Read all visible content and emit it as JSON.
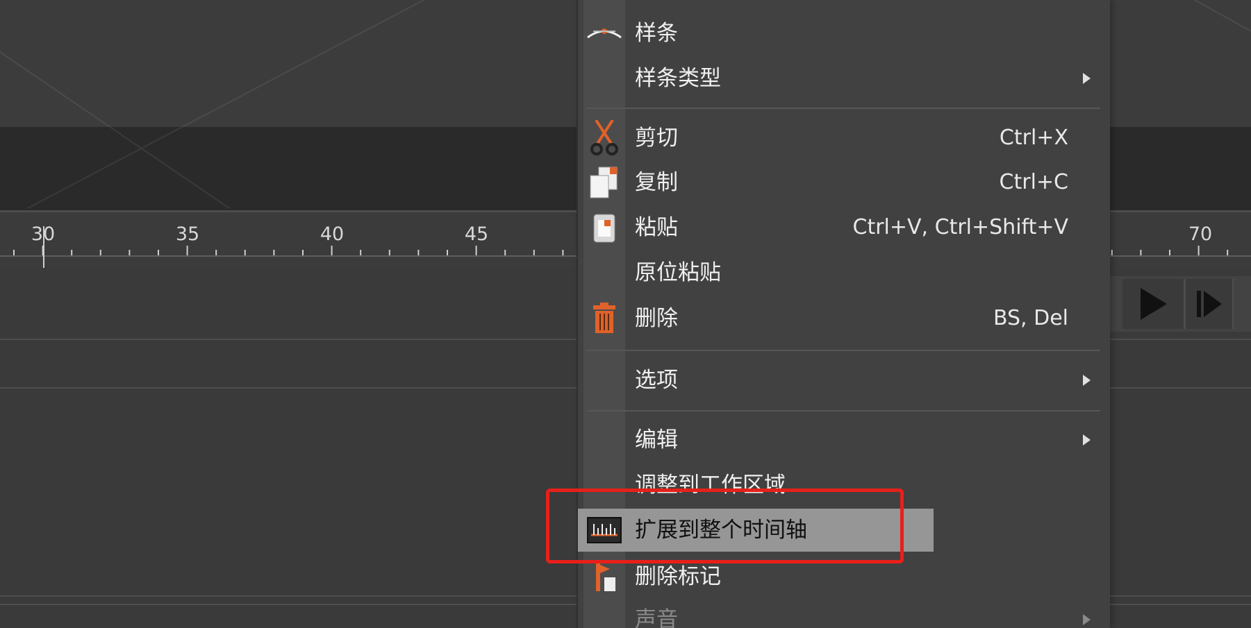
{
  "ruler": {
    "labels": [
      "30",
      "35",
      "40",
      "45",
      "70"
    ]
  },
  "menu": {
    "items": [
      {
        "label": "样条",
        "shortcut": "",
        "icon": "spline-curve-icon"
      },
      {
        "label": "样条类型",
        "shortcut": "",
        "icon": "",
        "submenu": true
      },
      {
        "label": "剪切",
        "shortcut": "Ctrl+X",
        "icon": "scissors-icon"
      },
      {
        "label": "复制",
        "shortcut": "Ctrl+C",
        "icon": "copy-icon"
      },
      {
        "label": "粘贴",
        "shortcut": "Ctrl+V, Ctrl+Shift+V",
        "icon": "paste-icon"
      },
      {
        "label": "原位粘贴",
        "shortcut": "",
        "icon": ""
      },
      {
        "label": "删除",
        "shortcut": "BS, Del",
        "icon": "trash-icon"
      },
      {
        "label": "选项",
        "shortcut": "",
        "icon": "",
        "submenu": true
      },
      {
        "label": "编辑",
        "shortcut": "",
        "icon": "",
        "submenu": true
      },
      {
        "label": "调整到工作区域",
        "shortcut": "",
        "icon": ""
      },
      {
        "label": "扩展到整个时间轴",
        "shortcut": "",
        "icon": "timeline-ruler-icon",
        "highlighted": true
      },
      {
        "label": "删除标记",
        "shortcut": "",
        "icon": "marker-icon"
      },
      {
        "label": "声音",
        "shortcut": "",
        "icon": "",
        "submenu": true,
        "disabled": true
      }
    ]
  },
  "colors": {
    "highlight_outline": "#e8201a",
    "icon_orange": "#e0622a",
    "menu_hover": "#969696"
  }
}
